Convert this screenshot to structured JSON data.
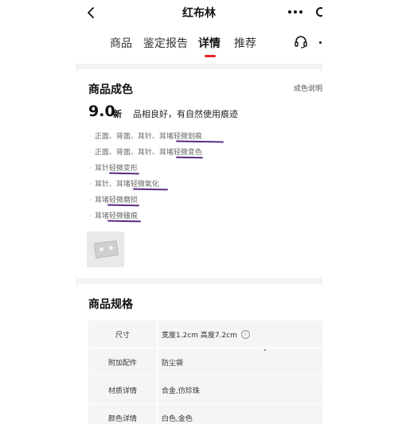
{
  "nav": {
    "title": "红布林",
    "back_icon": "chevron-left-icon",
    "more_icon": "more-dots-icon"
  },
  "tabs": [
    {
      "label": "商品"
    },
    {
      "label": "鉴定报告"
    },
    {
      "label": "详情",
      "active": true
    },
    {
      "label": "推荐"
    }
  ],
  "service_icon": "headset-icon",
  "condition": {
    "title": "商品成色",
    "link": "成色说明",
    "grade": "9.0",
    "grade_label": "新",
    "description": "品相良好，有自然使用痕迹",
    "flaws": [
      "正面、背面、耳针、耳堵轻微划痕",
      "正面、背面、耳针、耳堵轻微变色",
      "耳针轻微变形",
      "耳针、耳堵轻微氧化",
      "耳堵轻微磨损",
      "耳堵轻微磕痕"
    ]
  },
  "spec": {
    "title": "商品规格",
    "rows": [
      {
        "key": "尺寸",
        "value": "宽度1.2cm 高度7.2cm"
      },
      {
        "key": "附加配件",
        "value": "防尘袋"
      },
      {
        "key": "材质详情",
        "value": "合金,仿珍珠"
      },
      {
        "key": "颜色详情",
        "value": "白色,金色"
      }
    ]
  },
  "colors": {
    "accent": "#e8232c",
    "annotation": "#5a2a86",
    "page_bg": "#f3f3f3"
  }
}
